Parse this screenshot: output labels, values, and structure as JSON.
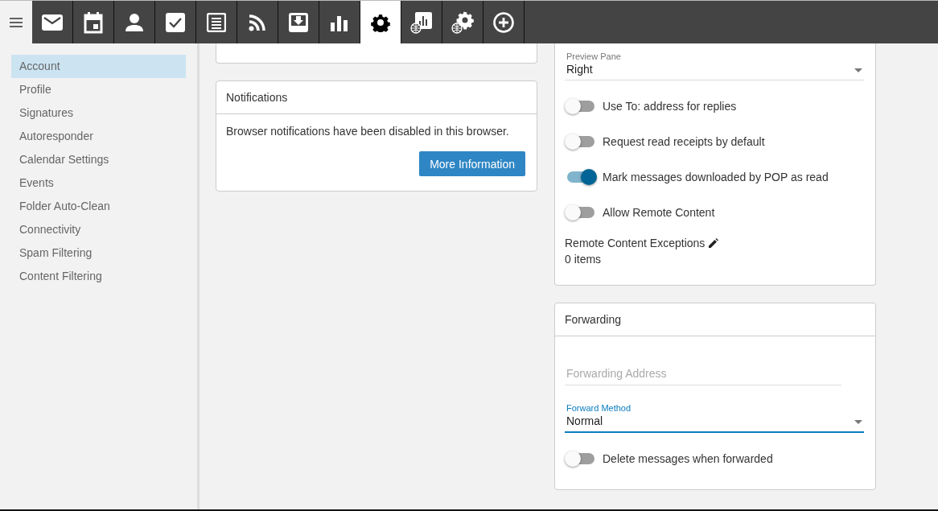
{
  "toolbar": {
    "tabs": [
      {
        "kind": "mail",
        "selected": false
      },
      {
        "kind": "calendar",
        "selected": false
      },
      {
        "kind": "contacts",
        "selected": false
      },
      {
        "kind": "tasks",
        "selected": false
      },
      {
        "kind": "notes",
        "selected": false
      },
      {
        "kind": "feeds",
        "selected": false
      },
      {
        "kind": "archive",
        "selected": false
      },
      {
        "kind": "reports",
        "selected": false
      },
      {
        "kind": "settings",
        "selected": true
      },
      {
        "kind": "web-reports",
        "selected": false
      },
      {
        "kind": "web-settings",
        "selected": false
      },
      {
        "kind": "add",
        "selected": false
      }
    ]
  },
  "sidebar": {
    "items": [
      {
        "label": "Account",
        "selected": true
      },
      {
        "label": "Profile",
        "selected": false
      },
      {
        "label": "Signatures",
        "selected": false
      },
      {
        "label": "Autoresponder",
        "selected": false
      },
      {
        "label": "Calendar Settings",
        "selected": false
      },
      {
        "label": "Events",
        "selected": false
      },
      {
        "label": "Folder Auto-Clean",
        "selected": false
      },
      {
        "label": "Connectivity",
        "selected": false
      },
      {
        "label": "Spam Filtering",
        "selected": false
      },
      {
        "label": "Content Filtering",
        "selected": false
      }
    ]
  },
  "notifications": {
    "title": "Notifications",
    "message": "Browser notifications have been disabled in this browser.",
    "button": "More Information"
  },
  "display": {
    "preview_pane": {
      "label": "Preview Pane",
      "value": "Right",
      "focused": false
    },
    "toggles": [
      {
        "label": "Use To: address for replies",
        "on": false
      },
      {
        "label": "Request read receipts by default",
        "on": false
      },
      {
        "label": "Mark messages downloaded by POP as read",
        "on": true
      },
      {
        "label": "Allow Remote Content",
        "on": false
      }
    ],
    "exceptions": {
      "label": "Remote Content Exceptions",
      "count": "0 items"
    }
  },
  "forwarding": {
    "title": "Forwarding",
    "address": {
      "placeholder": "Forwarding Address"
    },
    "method": {
      "label": "Forward Method",
      "value": "Normal",
      "focused": true
    },
    "toggles": [
      {
        "label": "Delete messages when forwarded",
        "on": false
      }
    ]
  }
}
